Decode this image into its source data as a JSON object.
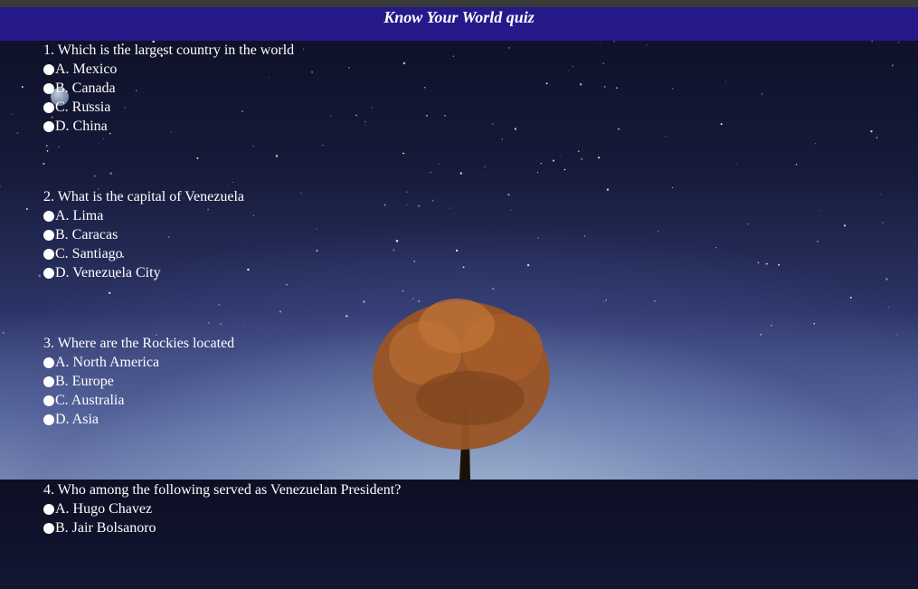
{
  "header": {
    "title": "Know Your World quiz"
  },
  "quiz": {
    "questions": [
      {
        "text": "1. Which is the largest country in the world",
        "options": [
          "A. Mexico",
          "B. Canada",
          "C. Russia",
          "D. China"
        ]
      },
      {
        "text": "2. What is the capital of Venezuela",
        "options": [
          "A. Lima",
          "B. Caracas",
          "C. Santiago",
          "D. Venezuela City"
        ]
      },
      {
        "text": "3. Where are the Rockies located",
        "options": [
          "A. North America",
          "B. Europe",
          "C. Australia",
          "D. Asia"
        ]
      },
      {
        "text": "4. Who among the following served as Venezuelan President?",
        "options": [
          "A. Hugo Chavez",
          "B. Jair Bolsanoro"
        ]
      }
    ]
  },
  "colors": {
    "header_bg": "#26198a",
    "text": "#ffffff",
    "sky_top": "#0d0f24",
    "horizon": "#8fa2c4",
    "tree_foliage": "#b0622a"
  }
}
